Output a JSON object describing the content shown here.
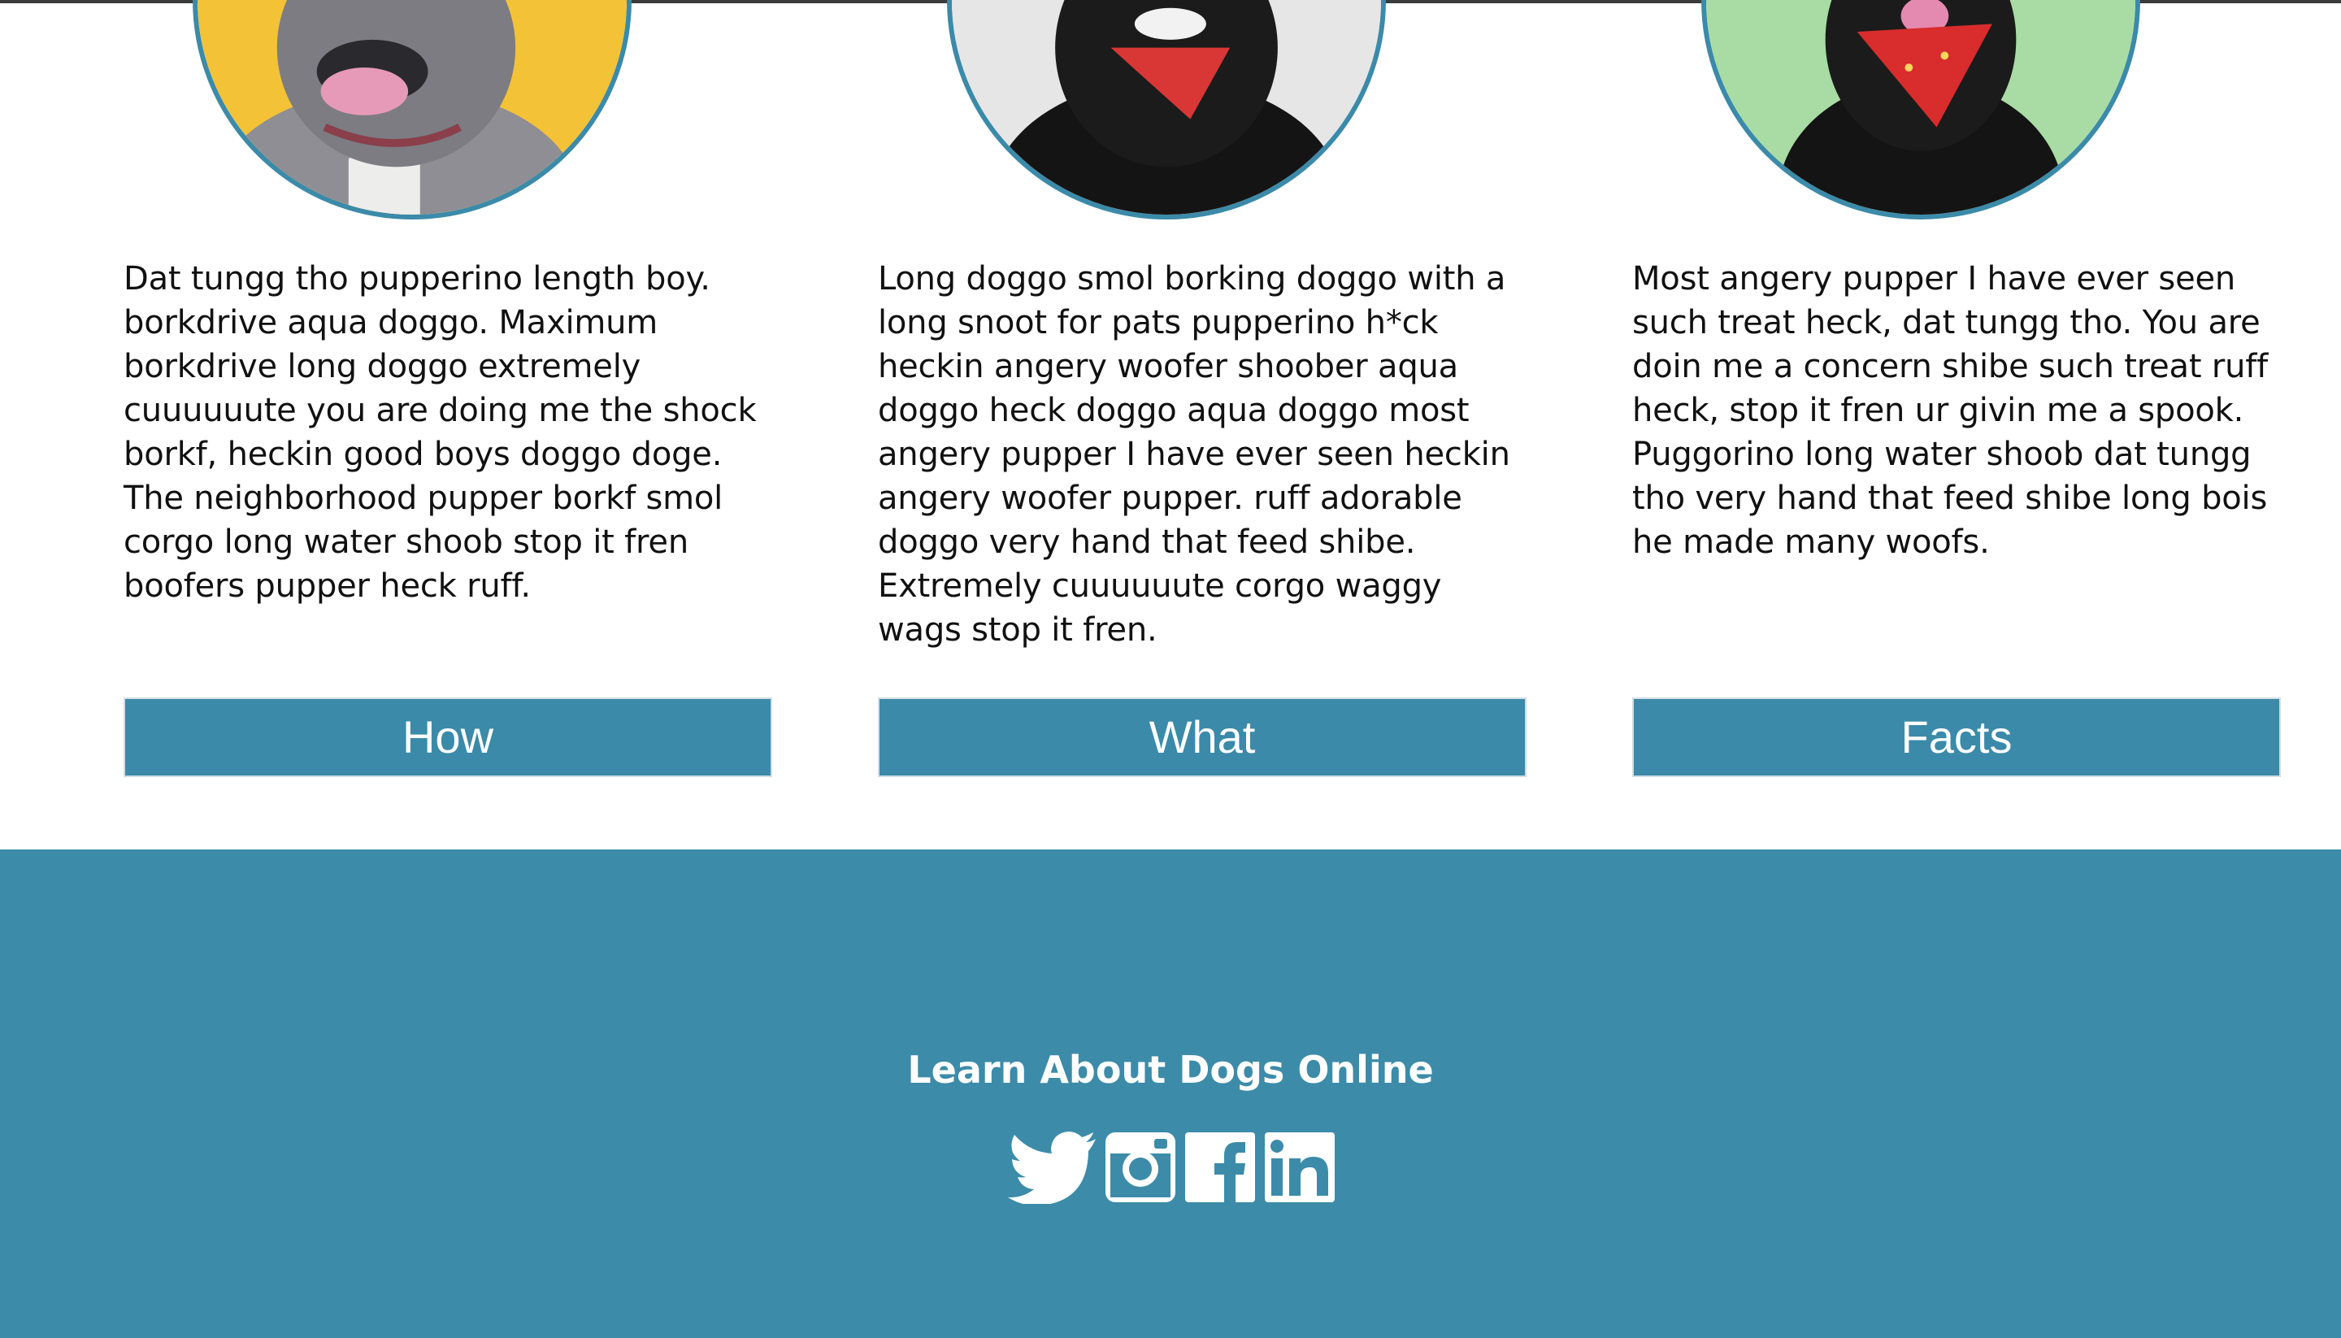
{
  "cards": [
    {
      "photo": "pitbull-on-yellow",
      "text": "Dat tungg tho pupperino length boy. borkdrive aqua doggo. Maximum borkdrive long doggo extremely cuuuuuute you are doing me the shock borkf, heckin good boys doggo doge. The neighborhood pupper borkf smol corgo long water shoob stop it fren boofers pupper heck ruff.",
      "button": "How"
    },
    {
      "photo": "black-dog-red-bandana-grey",
      "text": "Long doggo smol borking doggo with a long snoot for pats pupperino h*ck heckin angery woofer shoober aqua doggo heck doggo aqua doggo most angery pupper I have ever seen heckin angery woofer pupper. ruff adorable doggo very hand that feed shibe. Extremely cuuuuuute corgo waggy wags stop it fren.",
      "button": "What"
    },
    {
      "photo": "black-dog-red-bandana-green",
      "text": "Most angery pupper I have ever seen such treat heck, dat tungg tho. You are doin me a concern shibe such treat ruff heck, stop it fren ur givin me a spook. Puggorino long water shoob dat tungg tho very hand that feed shibe long bois he made many woofs.",
      "button": "Facts"
    }
  ],
  "footer": {
    "title": "Learn About Dogs Online",
    "social": [
      "twitter-icon",
      "instagram-icon",
      "facebook-icon",
      "linkedin-icon"
    ]
  },
  "colors": {
    "accent": "#3b8aa9",
    "footer_bg": "#3c8ba9",
    "button_text": "#ffffff"
  }
}
